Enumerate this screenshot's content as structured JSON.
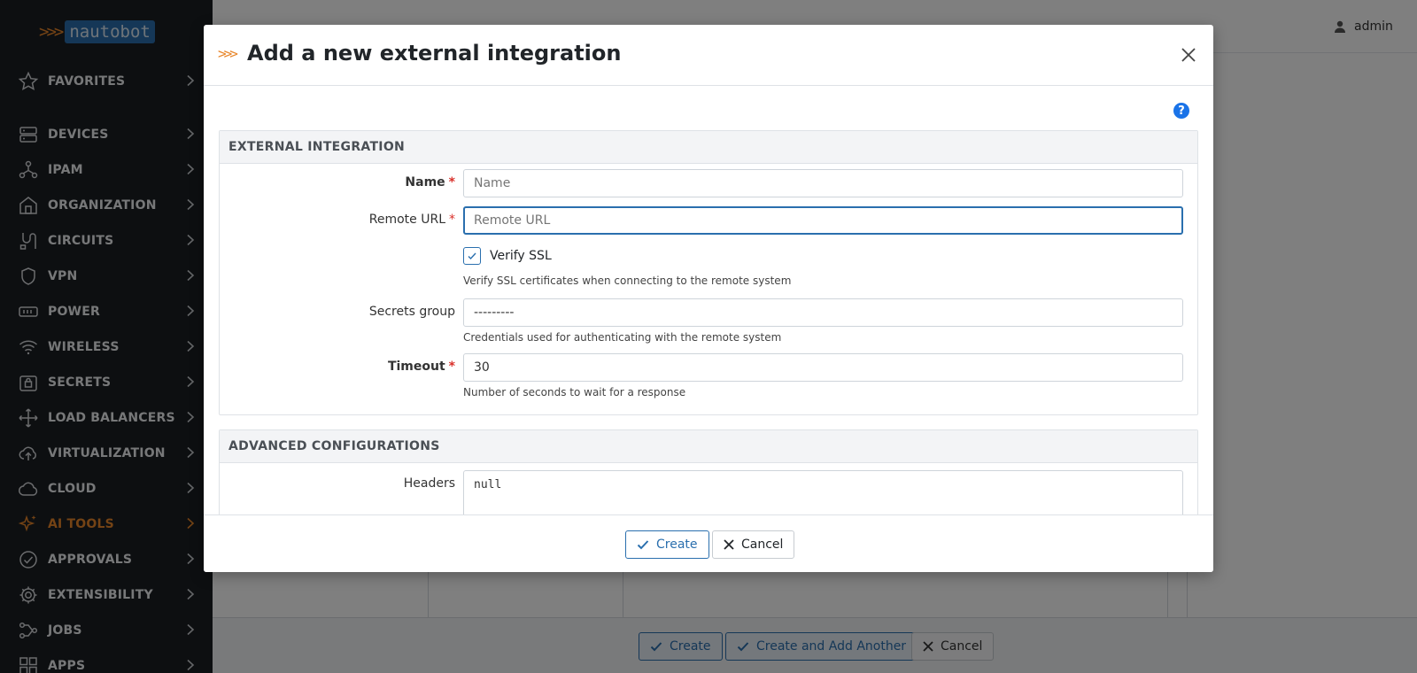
{
  "sidebar": {
    "logo_text": "nautobot",
    "logo_chevrons": ">>>",
    "items": [
      {
        "label": "FAVORITES",
        "icon": "star-icon"
      },
      {
        "label": "DEVICES",
        "icon": "server-icon"
      },
      {
        "label": "IPAM",
        "icon": "network-icon"
      },
      {
        "label": "ORGANIZATION",
        "icon": "building-icon"
      },
      {
        "label": "CIRCUITS",
        "icon": "cable-icon"
      },
      {
        "label": "VPN",
        "icon": "shield-icon"
      },
      {
        "label": "POWER",
        "icon": "power-strip-icon"
      },
      {
        "label": "WIRELESS",
        "icon": "wifi-icon"
      },
      {
        "label": "SECRETS",
        "icon": "lock-icon"
      },
      {
        "label": "LOAD BALANCERS",
        "icon": "load-balancer-icon"
      },
      {
        "label": "VIRTUALIZATION",
        "icon": "cloud-upload-icon"
      },
      {
        "label": "CLOUD",
        "icon": "cloud-icon"
      },
      {
        "label": "AI TOOLS",
        "icon": "sparkle-icon",
        "active": true
      },
      {
        "label": "APPROVALS",
        "icon": "check-circle-icon"
      },
      {
        "label": "EXTENSIBILITY",
        "icon": "gear-icon"
      },
      {
        "label": "JOBS",
        "icon": "jobs-icon"
      },
      {
        "label": "APPS",
        "icon": "apps-grid-icon"
      }
    ]
  },
  "topbar": {
    "user": "admin"
  },
  "background_footer": {
    "create_label": "Create",
    "create_another_label": "Create and Add Another",
    "cancel_label": "Cancel"
  },
  "modal": {
    "chevrons": ">>>",
    "title": "Add a new external integration",
    "section1": {
      "heading": "EXTERNAL INTEGRATION",
      "name_label": "Name",
      "name_placeholder": "Name",
      "remote_url_label": "Remote URL",
      "remote_url_placeholder": "Remote URL",
      "verify_ssl_label": "Verify SSL",
      "verify_ssl_checked": true,
      "verify_ssl_help": "Verify SSL certificates when connecting to the remote system",
      "secrets_group_label": "Secrets group",
      "secrets_group_value": "---------",
      "secrets_group_help": "Credentials used for authenticating with the remote system",
      "timeout_label": "Timeout",
      "timeout_value": "30",
      "timeout_help": "Number of seconds to wait for a response",
      "required_marker": "*"
    },
    "section2": {
      "heading": "ADVANCED CONFIGURATIONS",
      "headers_label": "Headers",
      "headers_value": "null"
    },
    "help_icon_text": "?",
    "footer": {
      "create_label": "Create",
      "cancel_label": "Cancel"
    }
  },
  "colors": {
    "accent": "#2a6fae",
    "brand_orange": "#e8862a",
    "sidebar_bg": "#1b1e22",
    "required": "#d9302a"
  }
}
